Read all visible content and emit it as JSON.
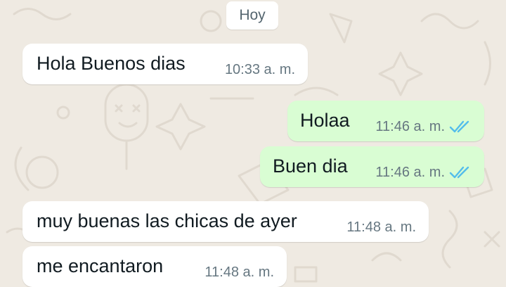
{
  "date_separator": "Hoy",
  "colors": {
    "background": "#efeae2",
    "incoming_bubble": "#ffffff",
    "outgoing_bubble": "#d9fdd3",
    "read_ticks": "#53bdeb"
  },
  "messages": [
    {
      "direction": "incoming",
      "text": "Hola Buenos dias",
      "time": "10:33 a. m."
    },
    {
      "direction": "outgoing",
      "text": "Holaa",
      "time": "11:46 a. m.",
      "status_icon": "double-check-read-icon"
    },
    {
      "direction": "outgoing",
      "text": "Buen dia",
      "time": "11:46 a. m.",
      "status_icon": "double-check-read-icon"
    },
    {
      "direction": "incoming",
      "text": "muy buenas las chicas de ayer",
      "time": "11:48 a. m."
    },
    {
      "direction": "incoming",
      "text": "me encantaron",
      "time": "11:48 a. m."
    }
  ]
}
